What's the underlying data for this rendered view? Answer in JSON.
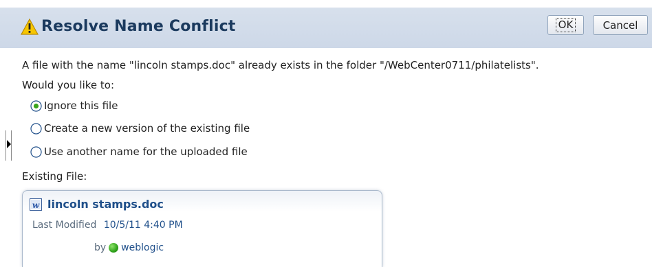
{
  "dialog": {
    "title": "Resolve Name Conflict",
    "ok_label": "OK",
    "cancel_label": "Cancel"
  },
  "body": {
    "message": "A file with the name \"lincoln stamps.doc\" already exists in the folder \"/WebCenter0711/philatelists\".",
    "prompt": "Would you like to:",
    "options": [
      {
        "label": "Ignore this file",
        "selected": true
      },
      {
        "label": "Create a new version of the existing file",
        "selected": false
      },
      {
        "label": "Use another name for the uploaded file",
        "selected": false
      }
    ],
    "existing_label": "Existing File:"
  },
  "existing_file": {
    "name": "lincoln stamps.doc",
    "icon": "word-doc-icon",
    "modified_label": "Last Modified",
    "modified_value": "10/5/11 4:40 PM",
    "by_label": "by",
    "user": "weblogic",
    "presence_icon": "online-status-icon"
  },
  "colors": {
    "header_bg": "#cdd8e8",
    "title_text": "#1b3a5e",
    "link_text": "#1f4f8a",
    "presence_online": "#2fa21a"
  }
}
